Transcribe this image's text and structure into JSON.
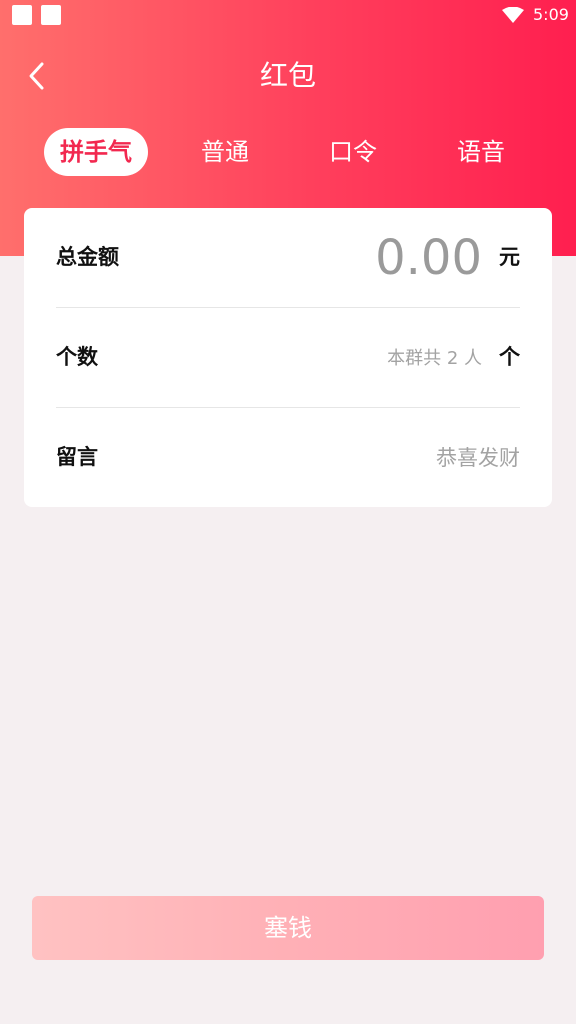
{
  "status_bar": {
    "time": "5:09",
    "icons": [
      "notification-square-icon",
      "notification-square-icon",
      "wifi-icon"
    ]
  },
  "header": {
    "back_icon": "chevron-left-icon",
    "title": "红包"
  },
  "tabs": [
    {
      "label": "拼手气",
      "active": true
    },
    {
      "label": "普通",
      "active": false
    },
    {
      "label": "口令",
      "active": false
    },
    {
      "label": "语音",
      "active": false
    }
  ],
  "form": {
    "amount": {
      "label": "总金额",
      "placeholder": "0.00",
      "unit": "元"
    },
    "count": {
      "label": "个数",
      "placeholder": "本群共 2 人",
      "unit": "个"
    },
    "message": {
      "label": "留言",
      "placeholder": "恭喜发财"
    }
  },
  "submit": {
    "label": "塞钱"
  },
  "colors": {
    "accent": "#f2284f",
    "header_gradient_start": "#ff6f6c",
    "header_gradient_end": "#ff1f4f",
    "background": "#f5eff1",
    "button_disabled": "#ffb0b6"
  }
}
